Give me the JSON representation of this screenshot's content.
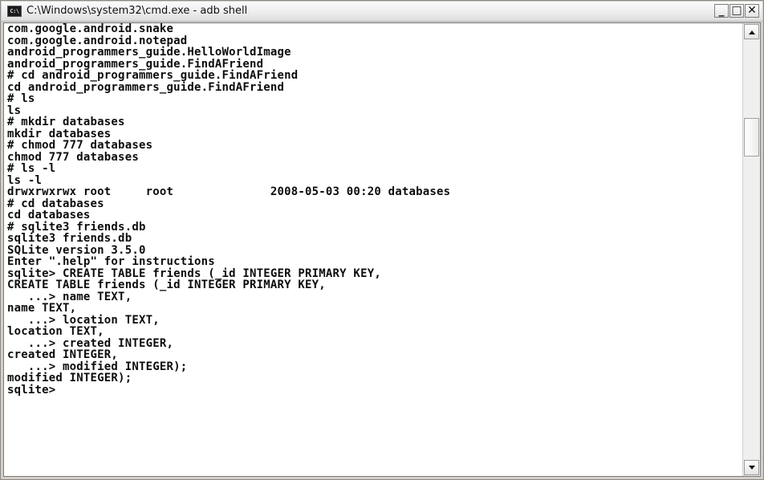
{
  "window": {
    "title": "C:\\Windows\\system32\\cmd.exe - adb  shell",
    "icon": "cmd-console-icon",
    "icon_text": "C:\\",
    "buttons": {
      "minimize": "_",
      "maximize": "□",
      "close": "✕"
    }
  },
  "console": {
    "lines": [
      "com.google.android.snake",
      "com.google.android.notepad",
      "android_programmers_guide.HelloWorldImage",
      "android_programmers_guide.FindAFriend",
      "# cd android_programmers_guide.FindAFriend",
      "cd android_programmers_guide.FindAFriend",
      "# ls",
      "ls",
      "# mkdir databases",
      "mkdir databases",
      "# chmod 777 databases",
      "chmod 777 databases",
      "# ls -l",
      "ls -l",
      "drwxrwxrwx root     root              2008-05-03 00:20 databases",
      "# cd databases",
      "cd databases",
      "# sqlite3 friends.db",
      "sqlite3 friends.db",
      "SQLite version 3.5.0",
      "Enter \".help\" for instructions",
      "sqlite> CREATE TABLE friends (_id INTEGER PRIMARY KEY,",
      "CREATE TABLE friends (_id INTEGER PRIMARY KEY,",
      "   ...> name TEXT,",
      "name TEXT,",
      "   ...> location TEXT,",
      "location TEXT,",
      "   ...> created INTEGER,",
      "created INTEGER,",
      "   ...> modified INTEGER);",
      "modified INTEGER);",
      "sqlite>"
    ]
  },
  "scrollbar": {
    "position": 0.18
  }
}
